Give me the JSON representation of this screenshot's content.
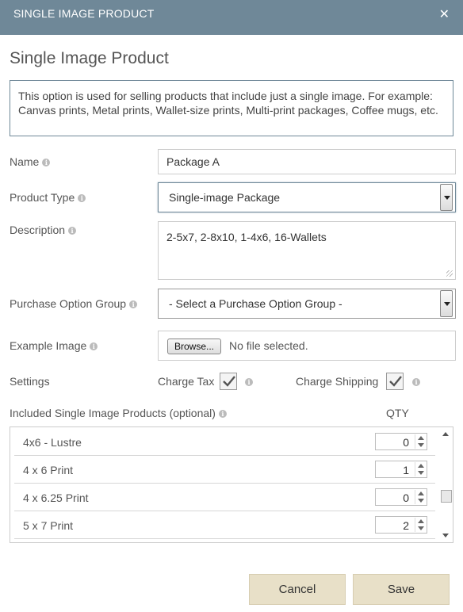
{
  "window": {
    "title": "SINGLE IMAGE PRODUCT",
    "close_symbol": "✕"
  },
  "heading": "Single Image Product",
  "info_text": "This option is used for selling products that include just a single image. For example: Canvas prints, Metal prints, Wallet-size prints, Multi-print packages, Coffee mugs, etc.",
  "form": {
    "name": {
      "label": "Name",
      "value": "Package A"
    },
    "product_type": {
      "label": "Product Type",
      "value": "Single-image Package"
    },
    "description": {
      "label": "Description",
      "value": "2-5x7, 2-8x10, 1-4x6, 16-Wallets"
    },
    "purchase_option_group": {
      "label": "Purchase Option Group",
      "value": "- Select a Purchase Option Group -"
    },
    "example_image": {
      "label": "Example Image",
      "button": "Browse...",
      "file_status": "No file selected."
    },
    "settings": {
      "label": "Settings",
      "charge_tax": {
        "label": "Charge Tax",
        "checked": true
      },
      "charge_shipping": {
        "label": "Charge Shipping",
        "checked": true
      }
    }
  },
  "included_products": {
    "label": "Included Single Image Products (optional)",
    "qty_header": "QTY",
    "rows": [
      {
        "name": "4x6 - Lustre",
        "qty": "0"
      },
      {
        "name": "4 x 6 Print",
        "qty": "1"
      },
      {
        "name": "4 x 6.25 Print",
        "qty": "0"
      },
      {
        "name": "5 x 7 Print",
        "qty": "2"
      }
    ]
  },
  "buttons": {
    "cancel": "Cancel",
    "save": "Save"
  },
  "icons": {
    "info": "info-icon",
    "close": "close-icon",
    "checkmark": "checkmark-icon"
  },
  "colors": {
    "titlebar": "#6f8898",
    "button_bg": "#e8e0c8"
  }
}
